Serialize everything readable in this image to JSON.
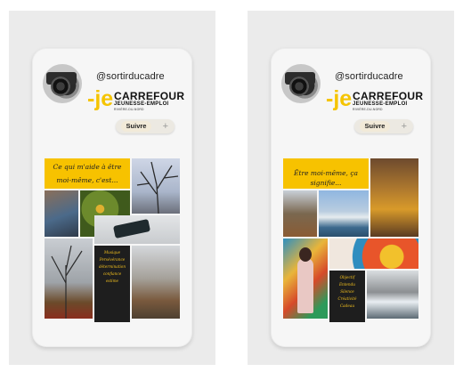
{
  "profiles": [
    {
      "handle": "@sortirducadre",
      "logo": {
        "mark": "-je",
        "name": "CARREFOUR",
        "sub": "JEUNESSE-EMPLOI",
        "region": "RIVIÈRE-DU-NORD"
      },
      "follow_label": "Suivre",
      "plus_icon": "+",
      "quote_lines": [
        "Ce qui m'aide à être",
        "moi-même, c'est..."
      ],
      "list_items": [
        "Musique",
        "Persévérance",
        "détermination",
        "confiance",
        "estime"
      ]
    },
    {
      "handle": "@sortirducadre",
      "logo": {
        "mark": "-je",
        "name": "CARREFOUR",
        "sub": "JEUNESSE-EMPLOI",
        "region": "RIVIÈRE-DU-NORD"
      },
      "follow_label": "Suivre",
      "plus_icon": "+",
      "quote_lines": [
        "Être moi-même, ça signifie..."
      ],
      "list_items": [
        "Objectif",
        "Entendu",
        "Silence",
        "Créativité",
        "Cadeau"
      ]
    }
  ]
}
